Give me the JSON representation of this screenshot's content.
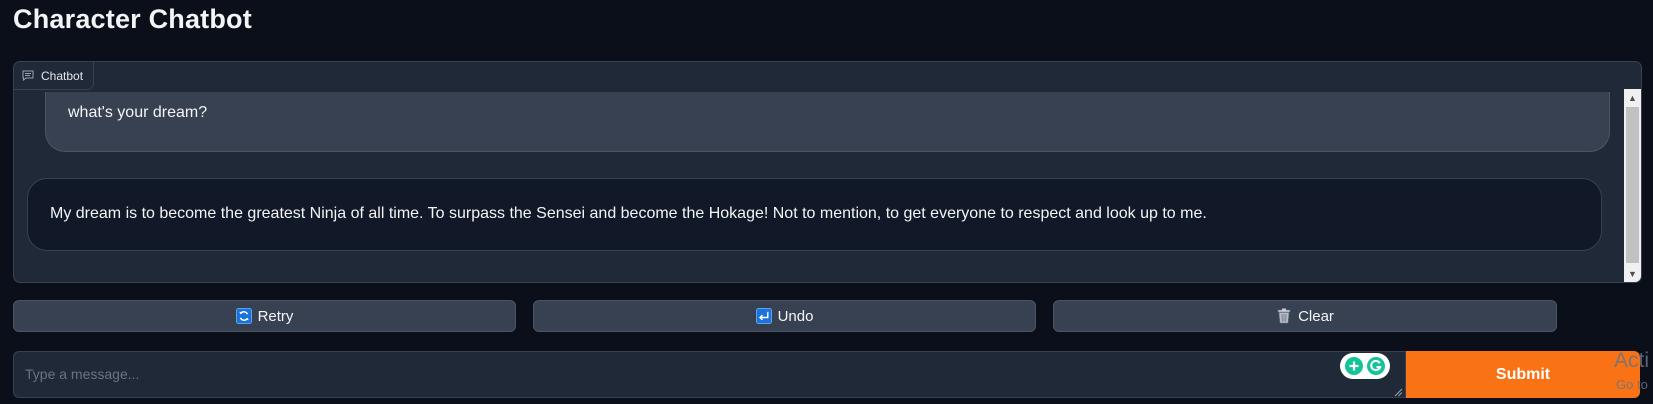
{
  "page": {
    "title": "Character Chatbot"
  },
  "chatbot": {
    "label": "Chatbot",
    "messages": [
      {
        "role": "user",
        "text": "what's your dream?"
      },
      {
        "role": "bot",
        "text": "My dream is to become the greatest Ninja of all time. To surpass the Sensei and become the Hokage! Not to mention, to get everyone to respect and look up to me."
      }
    ]
  },
  "actions": {
    "retry_label": "Retry",
    "undo_label": "Undo",
    "clear_label": "Clear"
  },
  "input": {
    "placeholder": "Type a message...",
    "value": "",
    "submit_label": "Submit"
  },
  "overlay": {
    "activation_line1": "Acti",
    "activation_line2": "Go to"
  },
  "icons": {
    "chatbot": "chat-bubble-icon",
    "retry": "refresh-icon",
    "undo": "undo-icon",
    "clear": "trash-icon",
    "extension": "grammarly-icon"
  },
  "colors": {
    "background": "#0b0f19",
    "panel": "#1f2937",
    "accent": "#f97316"
  }
}
